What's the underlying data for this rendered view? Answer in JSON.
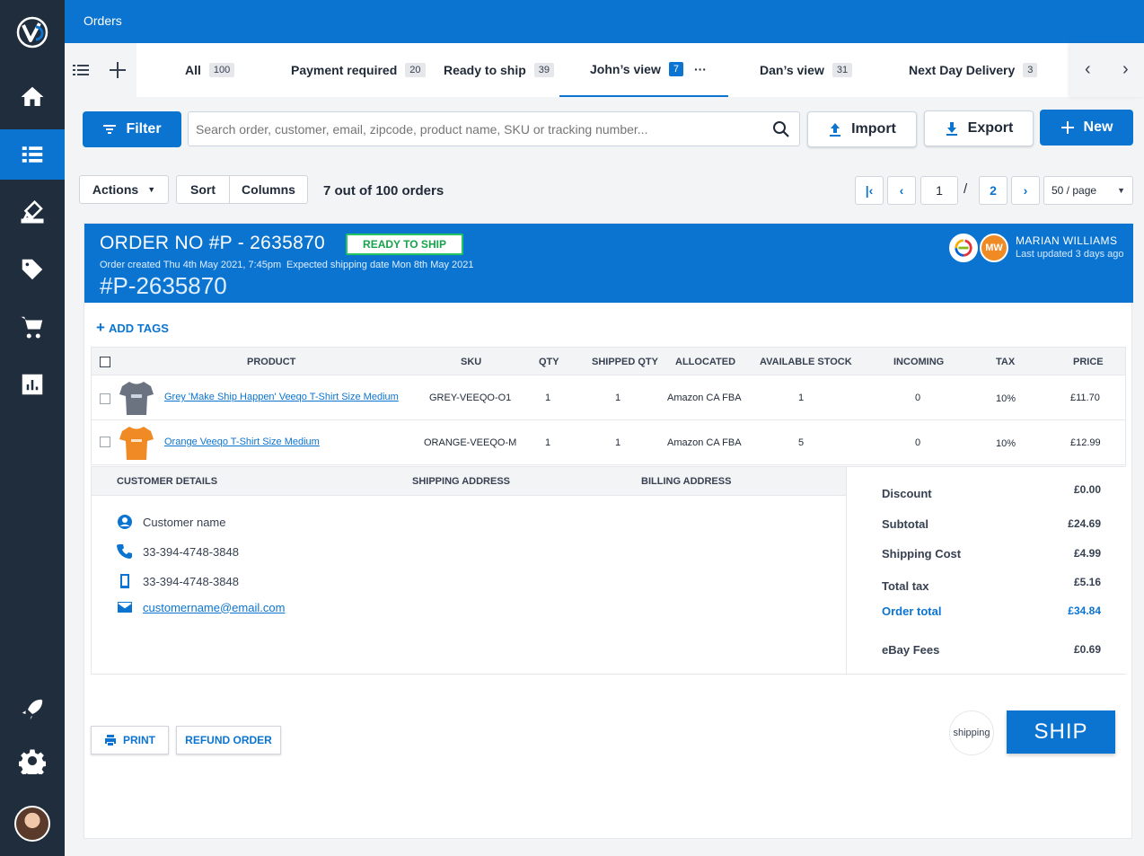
{
  "app": {
    "title": "Orders"
  },
  "sidebar": {
    "items": [
      {
        "name": "home-icon",
        "active": false
      },
      {
        "name": "orders-list-icon",
        "active": true
      },
      {
        "name": "inventory-icon",
        "active": false
      },
      {
        "name": "tag-icon",
        "active": false
      },
      {
        "name": "cart-icon",
        "active": false
      },
      {
        "name": "reports-icon",
        "active": false
      },
      {
        "name": "rocket-icon",
        "active": false
      },
      {
        "name": "gear-icon",
        "active": false
      }
    ]
  },
  "tabs": [
    {
      "label": "All",
      "count": "100",
      "active": false
    },
    {
      "label": "Payment required",
      "count": "20",
      "active": false
    },
    {
      "label": "Ready to ship",
      "count": "39",
      "active": false
    },
    {
      "label": "John’s view",
      "count": "7",
      "active": true,
      "more": "···"
    },
    {
      "label": "Dan’s view",
      "count": "31",
      "active": false
    },
    {
      "label": "Next Day Delivery",
      "count": "3",
      "active": false
    }
  ],
  "toolbar": {
    "filter_label": "Filter",
    "search_placeholder": "Search order, customer, email, zipcode, product name, SKU or tracking number...",
    "import_label": "Import",
    "export_label": "Export",
    "new_label": "New"
  },
  "subbar": {
    "actions_label": "Actions",
    "sort_label": "Sort",
    "columns_label": "Columns",
    "summary": "7 out of 100 orders",
    "page_current": "1",
    "page_sep": "/",
    "page_total": "2",
    "per_page": "50 / page"
  },
  "order": {
    "title": "ORDER NO #P - 2635870",
    "status": "READY TO SHIP",
    "created": "Order created Thu 4th May 2021, 7:45pm",
    "expected": "Expected shipping date Mon 8th May 2021",
    "ref": "#P-2635870",
    "user_initials": "MW",
    "user_name": "MARIAN WILLIAMS",
    "last_updated": "Last updated 3 days ago",
    "add_tags": "ADD TAGS",
    "status_color": "#16a34a",
    "accent": "#0b74d1"
  },
  "table": {
    "headers": [
      "PRODUCT",
      "SKU",
      "QTY",
      "SHIPPED QTY",
      "ALLOCATED",
      "AVAILABLE STOCK",
      "INCOMING",
      "TAX",
      "PRICE"
    ],
    "rows": [
      {
        "product": "Grey 'Make Ship Happen' Veeqo T-Shirt Size Medium",
        "sku": "GREY-VEEQO-O1",
        "qty": "1",
        "shipped": "1",
        "allocated": "Amazon CA FBA",
        "available": "1",
        "incoming": "0",
        "tax": "10%",
        "price": "£11.70",
        "shirt_color": "#6b7280"
      },
      {
        "product": "Orange Veeqo T-Shirt Size Medium",
        "sku": "ORANGE-VEEQO-M",
        "qty": "1",
        "shipped": "1",
        "allocated": "Amazon CA FBA",
        "available": "5",
        "incoming": "0",
        "tax": "10%",
        "price": "£12.99",
        "shirt_color": "#f08a24"
      }
    ]
  },
  "details": {
    "headers": [
      "CUSTOMER DETAILS",
      "SHIPPING ADDRESS",
      "BILLING ADDRESS"
    ],
    "customer_name": "Customer name",
    "phone": "33-394-4748-3848",
    "mobile": "33-394-4748-3848",
    "email": "customername@email.com"
  },
  "totals": [
    {
      "label": "Discount",
      "value": "£0.00"
    },
    {
      "label": "Subtotal",
      "value": "£24.69"
    },
    {
      "label": "Shipping Cost",
      "value": "£4.99"
    },
    {
      "label": "Total tax",
      "value": "£5.16"
    },
    {
      "label": "Order total",
      "value": "£34.84"
    },
    {
      "label": "eBay Fees",
      "value": "£0.69"
    }
  ],
  "actions": {
    "print_label": "PRINT",
    "refund_label": "REFUND ORDER",
    "shipping_logo": "shipping",
    "ship_label": "SHIP"
  }
}
